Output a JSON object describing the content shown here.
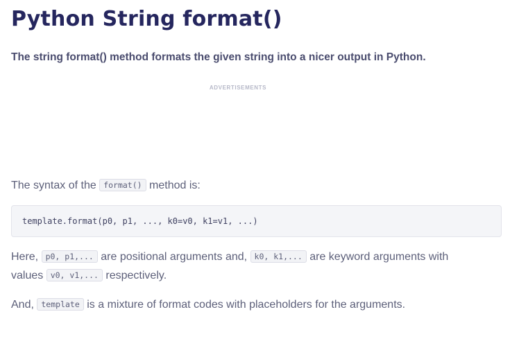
{
  "page": {
    "title": "Python String format()",
    "intro": "The string format() method formats the given string into a nicer output in Python.",
    "ad_label": "ADVERTISEMENTS"
  },
  "syntax": {
    "before": "The syntax of the",
    "code": "format()",
    "after": "method is:"
  },
  "code_block": {
    "content": "template.format(p0, p1, ..., k0=v0, k1=v1, ...)"
  },
  "explanation": {
    "line1": {
      "t1": "Here,",
      "c1": "p0, p1,...",
      "t2": "are positional arguments and,",
      "c2": "k0, k1,...",
      "t3": "are keyword arguments with"
    },
    "line2": {
      "t1": "values",
      "c1": "v0, v1,...",
      "t2": "respectively."
    }
  },
  "template_note": {
    "t1": "And,",
    "c1": "template",
    "t2": "is a mixture of format codes with placeholders for the arguments."
  },
  "colors": {
    "heading": "#25265e",
    "body_text": "#5c5f79",
    "code_background": "#f4f5f8"
  }
}
